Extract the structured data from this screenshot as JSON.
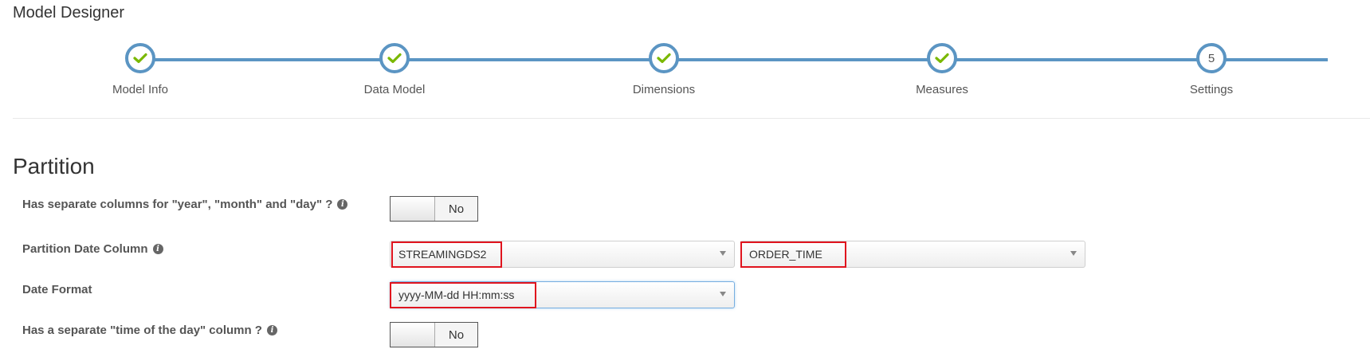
{
  "header": {
    "title": "Model Designer"
  },
  "wizard": {
    "steps": [
      {
        "label": "Model Info",
        "done": true
      },
      {
        "label": "Data Model",
        "done": true
      },
      {
        "label": "Dimensions",
        "done": true
      },
      {
        "label": "Measures",
        "done": true
      },
      {
        "label": "Settings",
        "number": "5",
        "done": false
      }
    ],
    "accent_color": "#5b95c3",
    "check_color": "#7ab800"
  },
  "partition": {
    "title": "Partition",
    "separate_columns": {
      "label": "Has separate columns for \"year\", \"month\" and \"day\" ?",
      "value": "No",
      "icon": "info-icon"
    },
    "date_column": {
      "label": "Partition Date Column",
      "table": "STREAMINGDS2",
      "column": "ORDER_TIME",
      "icon": "info-icon"
    },
    "date_format": {
      "label": "Date Format",
      "value": "yyyy-MM-dd HH:mm:ss"
    },
    "time_column": {
      "label": "Has a separate \"time of the day\" column ?",
      "value": "No",
      "icon": "info-icon"
    },
    "highlight_color": "#e0141e"
  }
}
